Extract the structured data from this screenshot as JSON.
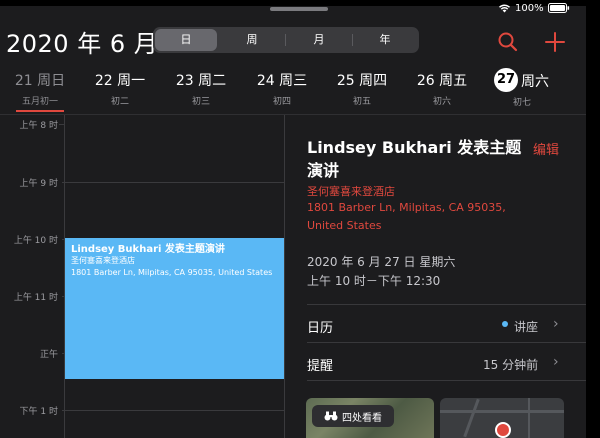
{
  "status": {
    "battery": "100%"
  },
  "header": {
    "title": "2020 年 6 月",
    "segments": [
      "日",
      "周",
      "月",
      "年"
    ],
    "active_segment": "日"
  },
  "week": {
    "days": [
      {
        "label": "21 周日",
        "sub": "五月初一",
        "past": true
      },
      {
        "label": "22 周一",
        "sub": "初二"
      },
      {
        "label": "23 周二",
        "sub": "初三"
      },
      {
        "label": "24 周三",
        "sub": "初四"
      },
      {
        "label": "25 周四",
        "sub": "初五"
      },
      {
        "label": "26 周五",
        "sub": "初六"
      }
    ],
    "today": {
      "number": "27",
      "label": "周六",
      "sub": "初七"
    }
  },
  "timeline": {
    "hours": [
      "上午 8 时",
      "上午 9 时",
      "上午 10 时",
      "上午 11 时",
      "正午",
      "下午 1 时"
    ]
  },
  "event": {
    "title": "Lindsey Bukhari 发表主题演讲",
    "location": "圣何塞喜来登酒店",
    "address": "1801 Barber Ln, Milpitas, CA  95035, United States"
  },
  "detail": {
    "title": "Lindsey Bukhari 发表主题演讲",
    "edit_label": "编辑",
    "location": "圣何塞喜来登酒店",
    "address": "1801 Barber Ln, Milpitas, CA  95035, United States",
    "date": "2020 年 6 月 27 日 星期六",
    "time": "上午 10 时－下午 12:30",
    "calendar_label": "日历",
    "calendar_value": "讲座",
    "alert_label": "提醒",
    "alert_value": "15 分钟前",
    "look_around": "四处看看"
  },
  "colors": {
    "accent": "#e0483e",
    "event": "#5ab8f5"
  }
}
